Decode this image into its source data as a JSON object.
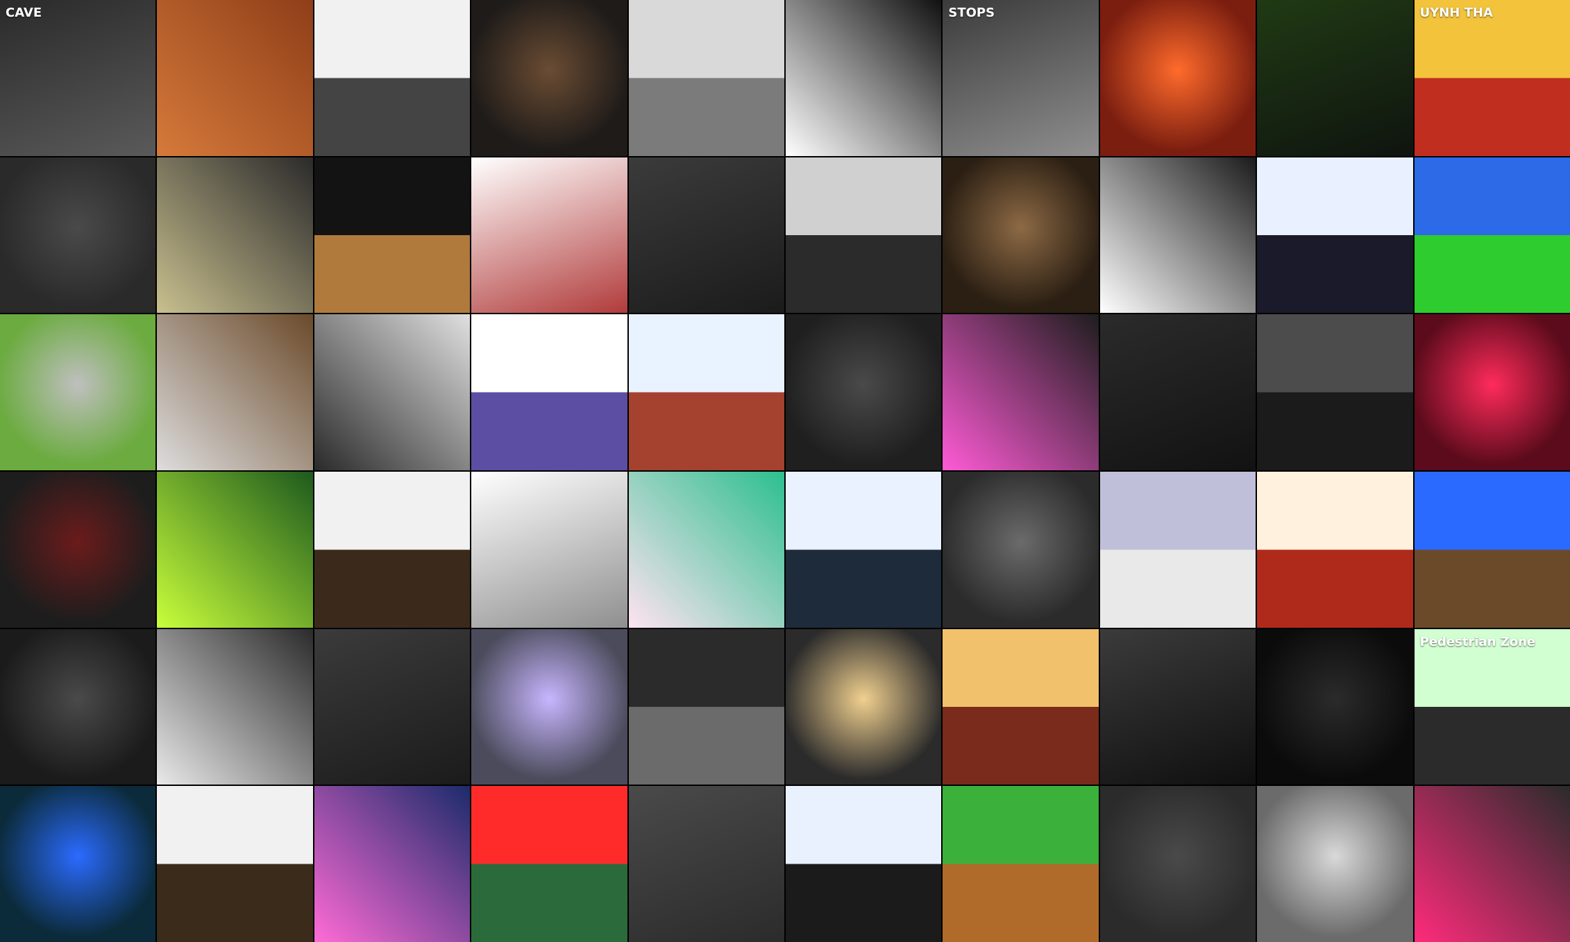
{
  "grid": {
    "columns": 10,
    "rows": 6,
    "tiles": [
      {
        "label": "CAVE",
        "a": "#2a2a2a",
        "b": "#5a5a5a",
        "style": "v-gradient"
      },
      {
        "label": "",
        "a": "#d57a3a",
        "b": "#8f3e19",
        "style": "v-diag"
      },
      {
        "label": "",
        "a": "#f1f1f1",
        "b": "#444",
        "style": "v-split"
      },
      {
        "label": "",
        "a": "#6b4c33",
        "b": "#1e1b19",
        "style": "v-radial"
      },
      {
        "label": "",
        "a": "#d9d9d9",
        "b": "#7b7b7b",
        "style": "v-split"
      },
      {
        "label": "",
        "a": "#ffffff",
        "b": "#111111",
        "style": "v-diag"
      },
      {
        "label": "STOPS",
        "a": "#3b3b3b",
        "b": "#8f8f8f",
        "style": "v-gradient"
      },
      {
        "label": "",
        "a": "#ff6b2b",
        "b": "#7b1e10",
        "style": "v-radial"
      },
      {
        "label": "",
        "a": "#203a14",
        "b": "#0f140f",
        "style": "v-gradient"
      },
      {
        "label": "UYNH THA",
        "a": "#f2c33b",
        "b": "#c02e1f",
        "style": "v-split"
      },
      {
        "label": "",
        "a": "#4a4a4a",
        "b": "#2a2a2a",
        "style": "v-radial"
      },
      {
        "label": "",
        "a": "#c9c08f",
        "b": "#2a2a2a",
        "style": "v-diag"
      },
      {
        "label": "",
        "a": "#131313",
        "b": "#b07a3c",
        "style": "v-split"
      },
      {
        "label": "",
        "a": "#ffffff",
        "b": "#b13b3b",
        "style": "v-gradient"
      },
      {
        "label": "",
        "a": "#3b3b3b",
        "b": "#1b1b1b",
        "style": "v-gradient"
      },
      {
        "label": "",
        "a": "#d0d0d0",
        "b": "#2b2b2b",
        "style": "v-split"
      },
      {
        "label": "",
        "a": "#8d6a45",
        "b": "#2b1f13",
        "style": "v-radial"
      },
      {
        "label": "",
        "a": "#ffffff",
        "b": "#1b1b1b",
        "style": "v-diag"
      },
      {
        "label": "",
        "a": "#e9f0ff",
        "b": "#1a1a2a",
        "style": "v-split"
      },
      {
        "label": "",
        "a": "#2d6ae7",
        "b": "#2ecc2e",
        "style": "v-split"
      },
      {
        "label": "",
        "a": "#bfbfbf",
        "b": "#6bab3f",
        "style": "v-radial"
      },
      {
        "label": "",
        "a": "#dddddd",
        "b": "#6b4a2a",
        "style": "v-diag"
      },
      {
        "label": "",
        "a": "#2a2a2a",
        "b": "#e0e0e0",
        "style": "v-diag"
      },
      {
        "label": "",
        "a": "#ffffff",
        "b": "#5b4ea3",
        "style": "v-split"
      },
      {
        "label": "",
        "a": "#e9f3ff",
        "b": "#a4422f",
        "style": "v-split"
      },
      {
        "label": "",
        "a": "#4a4a4a",
        "b": "#1f1f1f",
        "style": "v-radial"
      },
      {
        "label": "",
        "a": "#ff5bd6",
        "b": "#1d1d1d",
        "style": "v-diag"
      },
      {
        "label": "",
        "a": "#2b2b2b",
        "b": "#121212",
        "style": "v-gradient"
      },
      {
        "label": "",
        "a": "#4c4c4c",
        "b": "#1b1b1b",
        "style": "v-split"
      },
      {
        "label": "",
        "a": "#ff2b5b",
        "b": "#5b0b1b",
        "style": "v-radial"
      },
      {
        "label": "",
        "a": "#6b1b1b",
        "b": "#1d1d1d",
        "style": "v-radial"
      },
      {
        "label": "",
        "a": "#c9ff3b",
        "b": "#1d5a1d",
        "style": "v-diag"
      },
      {
        "label": "",
        "a": "#f1f1f1",
        "b": "#3b2a1b",
        "style": "v-split"
      },
      {
        "label": "",
        "a": "#ffffff",
        "b": "#8f8f8f",
        "style": "v-gradient"
      },
      {
        "label": "",
        "a": "#ffe3f0",
        "b": "#2cbf8f",
        "style": "v-diag"
      },
      {
        "label": "",
        "a": "#eaf1ff",
        "b": "#1d2b3b",
        "style": "v-split"
      },
      {
        "label": "",
        "a": "#6b6b6b",
        "b": "#2b2b2b",
        "style": "v-radial"
      },
      {
        "label": "",
        "a": "#bfbfd9",
        "b": "#e9e9e9",
        "style": "v-split"
      },
      {
        "label": "",
        "a": "#fff1dd",
        "b": "#b02a1b",
        "style": "v-split"
      },
      {
        "label": "",
        "a": "#2b6aff",
        "b": "#6b4a2a",
        "style": "v-split"
      },
      {
        "label": "",
        "a": "#4a4a4a",
        "b": "#1b1b1b",
        "style": "v-radial"
      },
      {
        "label": "",
        "a": "#e9e9e9",
        "b": "#2b2b2b",
        "style": "v-diag"
      },
      {
        "label": "",
        "a": "#3b3b3b",
        "b": "#1b1b1b",
        "style": "v-gradient"
      },
      {
        "label": "",
        "a": "#c7b6ff",
        "b": "#4b4b5b",
        "style": "v-radial"
      },
      {
        "label": "",
        "a": "#2b2b2b",
        "b": "#6b6b6b",
        "style": "v-split"
      },
      {
        "label": "",
        "a": "#f1d08f",
        "b": "#2b2b2b",
        "style": "v-radial"
      },
      {
        "label": "",
        "a": "#f2c16b",
        "b": "#7b2b1b",
        "style": "v-split"
      },
      {
        "label": "",
        "a": "#3b3b3b",
        "b": "#0f0f0f",
        "style": "v-gradient"
      },
      {
        "label": "",
        "a": "#2b2b2b",
        "b": "#0b0b0b",
        "style": "v-radial"
      },
      {
        "label": "Pedestrian Zone",
        "a": "#d2ffd2",
        "b": "#2b2b2b",
        "style": "v-split"
      },
      {
        "label": "",
        "a": "#2b6bff",
        "b": "#0b2b3b",
        "style": "v-radial"
      },
      {
        "label": "",
        "a": "#f1f1f1",
        "b": "#3b2b1b",
        "style": "v-split"
      },
      {
        "label": "",
        "a": "#ff6bd6",
        "b": "#1b2b6b",
        "style": "v-diag"
      },
      {
        "label": "",
        "a": "#ff2b2b",
        "b": "#2b6b3b",
        "style": "v-split"
      },
      {
        "label": "",
        "a": "#4a4a4a",
        "b": "#2b2b2b",
        "style": "v-gradient"
      },
      {
        "label": "",
        "a": "#e9f1ff",
        "b": "#1b1b1b",
        "style": "v-split"
      },
      {
        "label": "",
        "a": "#3bb03b",
        "b": "#b06b2b",
        "style": "v-split"
      },
      {
        "label": "",
        "a": "#4a4a4a",
        "b": "#2b2b2b",
        "style": "v-radial"
      },
      {
        "label": "",
        "a": "#d9d9d9",
        "b": "#6b6b6b",
        "style": "v-radial"
      },
      {
        "label": "",
        "a": "#ff2b7b",
        "b": "#2b2b2b",
        "style": "v-diag"
      }
    ]
  }
}
